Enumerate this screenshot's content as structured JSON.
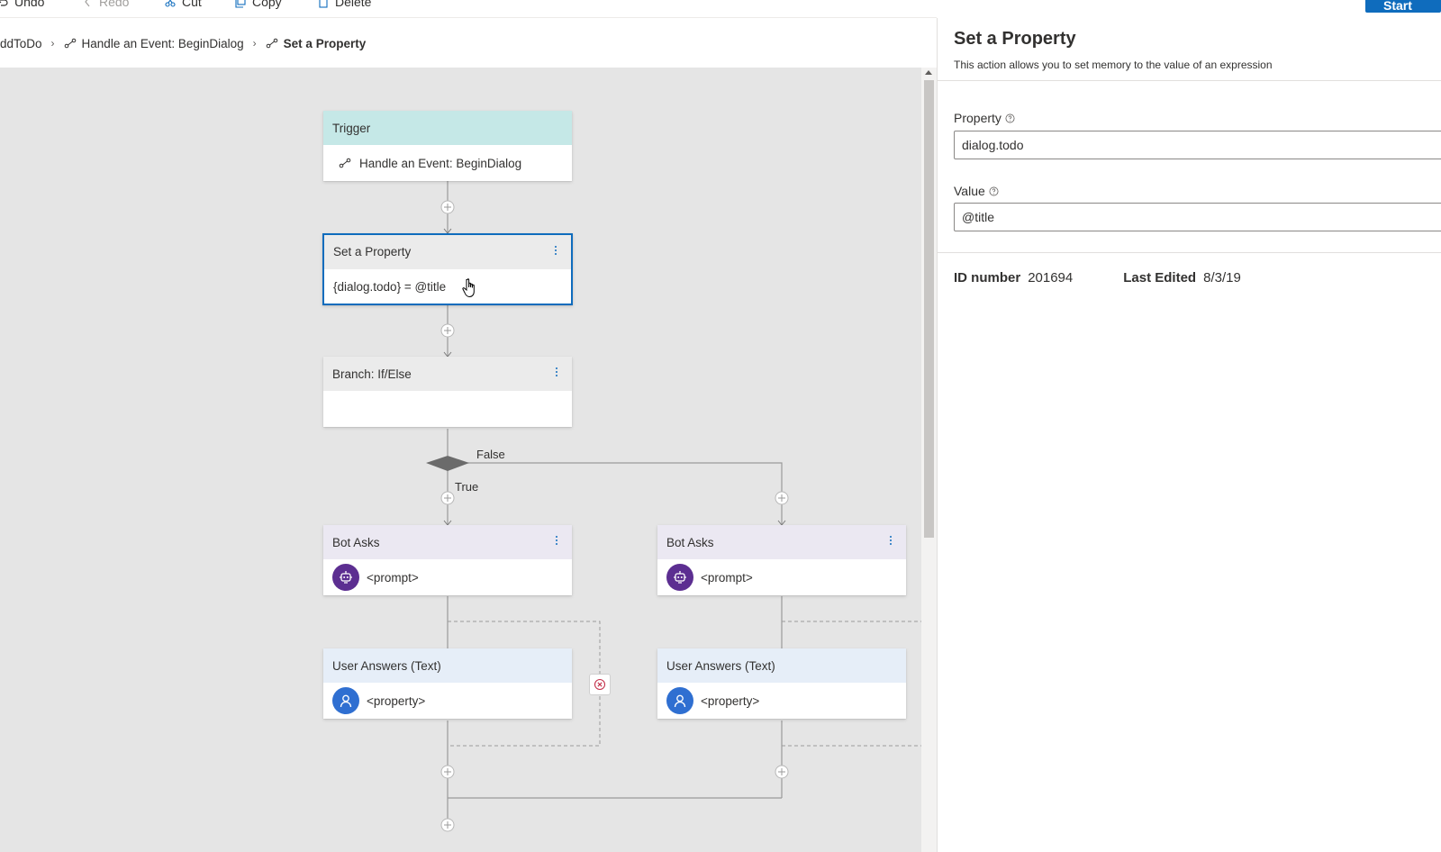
{
  "toolbar": {
    "undo": "Undo",
    "redo": "Redo",
    "cut": "Cut",
    "copy": "Copy",
    "delete": "Delete",
    "start": "Start"
  },
  "breadcrumb": [
    "ddToDo",
    "Handle an Event: BeginDialog",
    "Set a Property"
  ],
  "flow": {
    "trigger": {
      "title": "Trigger",
      "body": "Handle an Event: BeginDialog"
    },
    "set_property": {
      "title": "Set a Property",
      "body": "{dialog.todo} = @title"
    },
    "branch": {
      "title": "Branch: If/Else",
      "true_label": "True",
      "false_label": "False"
    },
    "left_bot": {
      "title": "Bot Asks",
      "body": "<prompt>"
    },
    "right_bot": {
      "title": "Bot Asks",
      "body": "<prompt>"
    },
    "left_user": {
      "title": "User Answers (Text)",
      "body": "<property>"
    },
    "right_user": {
      "title": "User Answers (Text)",
      "body": "<property>"
    }
  },
  "panel": {
    "title": "Set a Property",
    "description": "This action allows you to set memory to the value of an expression",
    "property_label": "Property",
    "property_value": "dialog.todo",
    "value_label": "Value",
    "value_value": "@title",
    "id_label": "ID number",
    "id_value": "201694",
    "edited_label": "Last Edited",
    "edited_value": "8/3/19"
  },
  "colors": {
    "accent": "#0f6cbd",
    "trigger_header": "#c5e8e7",
    "bot_avatar": "#5c2e91",
    "user_avatar": "#2f6fd1",
    "canvas_bg": "#e5e5e5"
  }
}
